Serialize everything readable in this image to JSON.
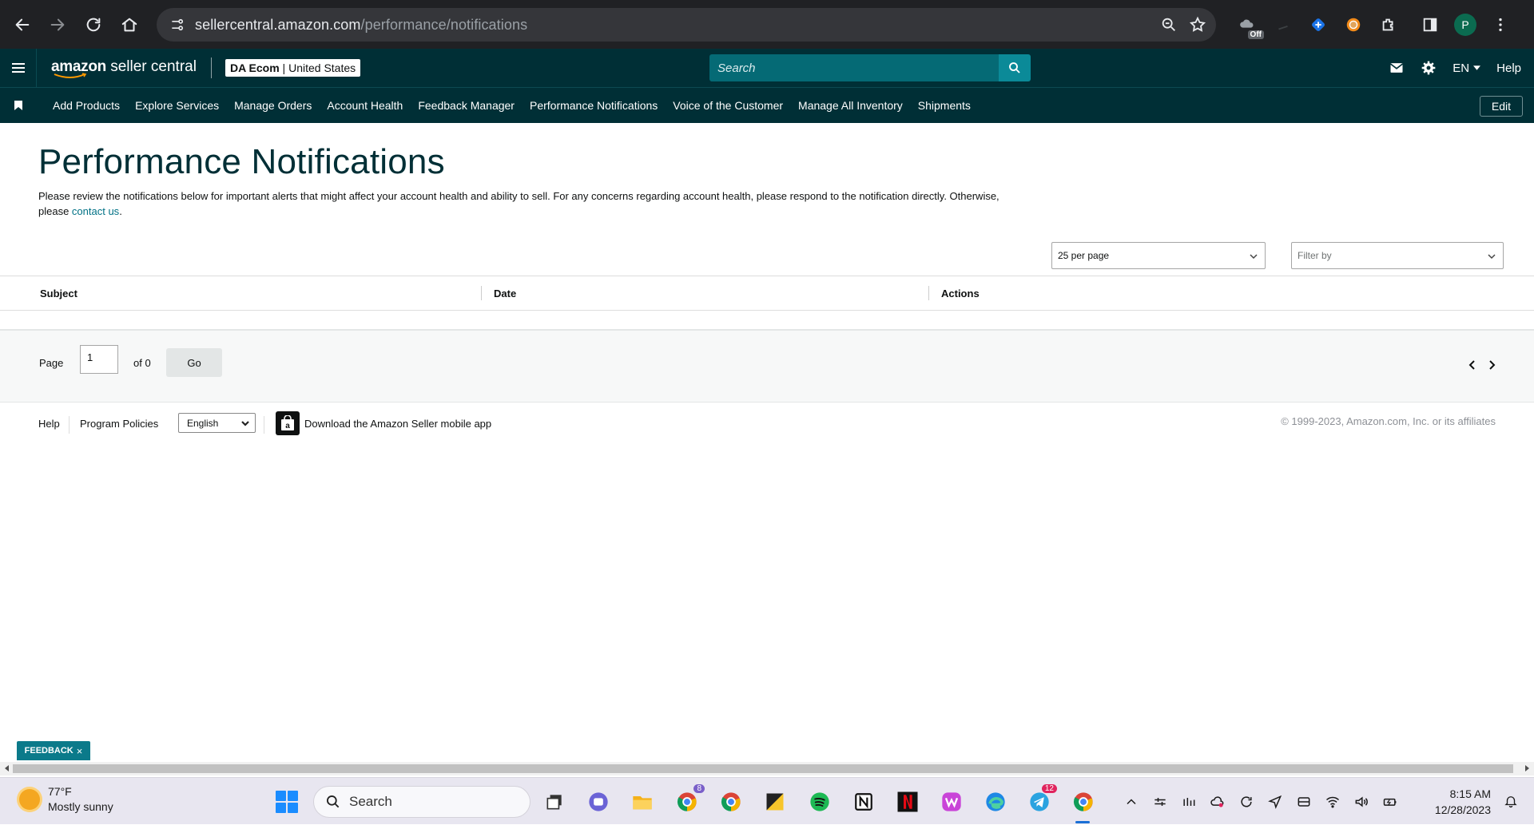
{
  "browser": {
    "url_host": "sellercentral.amazon.com",
    "url_path": "/performance/notifications",
    "profile_initial": "P",
    "ext_badge": "Off"
  },
  "header": {
    "logo_brand": "amazon",
    "logo_product": " seller central",
    "store_name": "DA Ecom",
    "store_sep": " | ",
    "store_region": "United States",
    "search_placeholder": "Search",
    "language": "EN",
    "help": "Help"
  },
  "nav": {
    "items": [
      {
        "label": "Add Products"
      },
      {
        "label": "Explore Services"
      },
      {
        "label": "Manage Orders"
      },
      {
        "label": "Account Health"
      },
      {
        "label": "Feedback Manager"
      },
      {
        "label": "Performance Notifications"
      },
      {
        "label": "Voice of the Customer"
      },
      {
        "label": "Manage All Inventory"
      },
      {
        "label": "Shipments"
      }
    ],
    "edit": "Edit"
  },
  "main": {
    "title": "Performance Notifications",
    "intro_text": "Please review the notifications below for important alerts that might affect your account health and ability to sell. For any concerns regarding account health, please respond to the notification directly. Otherwise, please ",
    "intro_link": "contact us",
    "intro_end": ".",
    "per_page": "25 per page",
    "filter_placeholder": "Filter by",
    "columns": {
      "subject": "Subject",
      "date": "Date",
      "actions": "Actions"
    },
    "pager": {
      "page_label": "Page",
      "page_value": "1",
      "of_label": "of 0",
      "go": "Go"
    }
  },
  "footer": {
    "help": "Help",
    "program_policies": "Program Policies",
    "language": "English",
    "app_download": "Download the Amazon Seller mobile app",
    "copyright": "© 1999-2023, Amazon.com, Inc. or its affiliates"
  },
  "feedback_tab": {
    "label": "FEEDBACK",
    "close": "×"
  },
  "taskbar": {
    "temperature": "77°F",
    "weather": "Mostly sunny",
    "search_placeholder": "Search",
    "chrome_badge": "8",
    "telegram_badge": "12",
    "time": "8:15 AM",
    "date": "12/28/2023"
  }
}
